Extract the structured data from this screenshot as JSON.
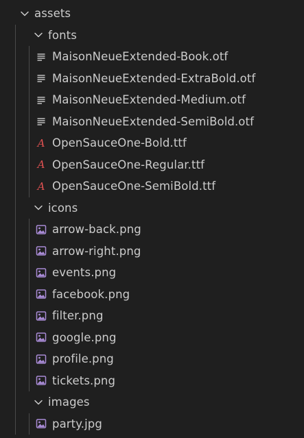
{
  "explorer": {
    "items": [
      {
        "label": "assets",
        "type": "folder",
        "expanded": true,
        "depth": 0
      },
      {
        "label": "fonts",
        "type": "folder",
        "expanded": true,
        "depth": 1
      },
      {
        "label": "MaisonNeueExtended-Book.otf",
        "type": "otf",
        "depth": 2
      },
      {
        "label": "MaisonNeueExtended-ExtraBold.otf",
        "type": "otf",
        "depth": 2
      },
      {
        "label": "MaisonNeueExtended-Medium.otf",
        "type": "otf",
        "depth": 2
      },
      {
        "label": "MaisonNeueExtended-SemiBold.otf",
        "type": "otf",
        "depth": 2
      },
      {
        "label": "OpenSauceOne-Bold.ttf",
        "type": "ttf",
        "depth": 2
      },
      {
        "label": "OpenSauceOne-Regular.ttf",
        "type": "ttf",
        "depth": 2
      },
      {
        "label": "OpenSauceOne-SemiBold.ttf",
        "type": "ttf",
        "depth": 2
      },
      {
        "label": "icons",
        "type": "folder",
        "expanded": true,
        "depth": 1
      },
      {
        "label": "arrow-back.png",
        "type": "image",
        "depth": 2
      },
      {
        "label": "arrow-right.png",
        "type": "image",
        "depth": 2
      },
      {
        "label": "events.png",
        "type": "image",
        "depth": 2
      },
      {
        "label": "facebook.png",
        "type": "image",
        "depth": 2
      },
      {
        "label": "filter.png",
        "type": "image",
        "depth": 2
      },
      {
        "label": "google.png",
        "type": "image",
        "depth": 2
      },
      {
        "label": "profile.png",
        "type": "image",
        "depth": 2
      },
      {
        "label": "tickets.png",
        "type": "image",
        "depth": 2
      },
      {
        "label": "images",
        "type": "folder",
        "expanded": true,
        "depth": 1
      },
      {
        "label": "party.jpg",
        "type": "image",
        "depth": 2
      }
    ]
  },
  "icons": {
    "folder_expanded": "chevron-down-icon",
    "otf": "lines-icon",
    "ttf": "font-a-icon",
    "image": "image-file-icon"
  },
  "colors": {
    "background": "#1f1f1f",
    "text": "#cccccc",
    "indent_guide": "#4a4a4a",
    "font_icon": "#e05252",
    "image_icon": "#a98bd6"
  }
}
